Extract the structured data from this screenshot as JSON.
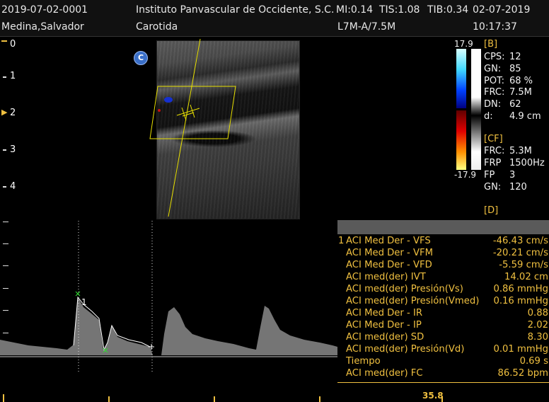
{
  "header": {
    "patient_id": "2019-07-02-0001",
    "institution": "Instituto Panvascular de Occidente, S.C.",
    "mi": "MI:0.14",
    "tis": "TIS:1.08",
    "tib": "TIB:0.34",
    "date": "02-07-2019",
    "patient_name": "Medina,Salvador",
    "exam": "Carotida",
    "probe": "L7M-A/7.5M",
    "time": "10:17:37"
  },
  "depth_scale": [
    "0",
    "1",
    "2",
    "3",
    "4"
  ],
  "color_scale": {
    "top": "17.9",
    "bottom": "-17.9"
  },
  "marker_c": "C",
  "bmode_params": {
    "section": "[B]",
    "items": [
      {
        "label": "CPS:",
        "value": "12"
      },
      {
        "label": "GN:",
        "value": "85"
      },
      {
        "label": "POT:",
        "value": "68 %"
      },
      {
        "label": "FRC:",
        "value": "7.5M"
      },
      {
        "label": "DN:",
        "value": "62"
      },
      {
        "label": "d:",
        "value": "4.9 cm"
      }
    ]
  },
  "cf_params": {
    "section": "[CF]",
    "items": [
      {
        "label": "FRC:",
        "value": "5.3M"
      },
      {
        "label": "FRP",
        "value": "1500Hz"
      },
      {
        "label": "FP",
        "value": "3"
      },
      {
        "label": "GN:",
        "value": "120"
      }
    ]
  },
  "d_section": "[D]",
  "measurements": {
    "index": "1",
    "rows": [
      {
        "label": "ACI Med Der - VFS",
        "value": "-46.43 cm/s"
      },
      {
        "label": "ACI Med Der - VFM",
        "value": "-20.21 cm/s"
      },
      {
        "label": "ACI Med Der - VFD",
        "value": "-5.59 cm/s"
      },
      {
        "label": "ACI med(der) IVT",
        "value": "14.02 cm"
      },
      {
        "label": "ACI med(der) Presión(Vs)",
        "value": "0.86 mmHg"
      },
      {
        "label": "ACI med(der) Presión(Vmed)",
        "value": "0.16 mmHg"
      },
      {
        "label": "ACI Med Der - IR",
        "value": "0.88"
      },
      {
        "label": "ACI Med Der - IP",
        "value": "2.02"
      },
      {
        "label": "ACI med(der) SD",
        "value": "8.30"
      },
      {
        "label": "ACI med(der) Presión(Vd)",
        "value": "0.01 mmHg"
      },
      {
        "label": "Tiempo",
        "value": "0.69 s"
      },
      {
        "label": "ACI med(der) FC",
        "value": "86.52 bpm"
      }
    ]
  },
  "bottom_value": "35.8",
  "cursor_label": "1",
  "colors": {
    "accent": "#f0c040",
    "roi": "#e8e000"
  }
}
